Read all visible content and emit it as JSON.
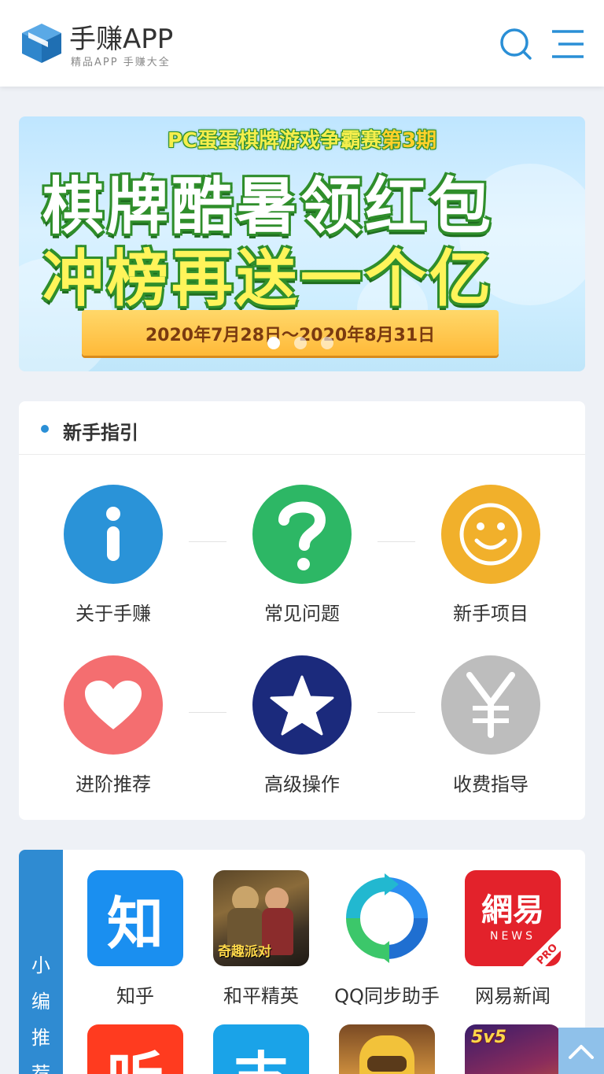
{
  "header": {
    "brand_title": "手赚APP",
    "brand_subtitle": "精品APP 手赚大全",
    "logo_icon": "cube-logo-icon",
    "search_icon": "search-icon",
    "menu_icon": "menu-icon",
    "accent": "#2a8fd6"
  },
  "banner": {
    "top_line_prefix": "PC蛋蛋棋牌游戏争霸赛",
    "top_line_highlight": "第3期",
    "line1": "棋牌酷暑领红包",
    "line2": "冲榜再送一个亿",
    "date_range": "2020年7月28日～2020年8月31日",
    "slides": 3,
    "active_slide": 1
  },
  "guide": {
    "title": "新手指引",
    "items": [
      {
        "label": "关于手赚",
        "icon": "info-icon",
        "color": "#2a93d8"
      },
      {
        "label": "常见问题",
        "icon": "question-icon",
        "color": "#2db765"
      },
      {
        "label": "新手项目",
        "icon": "smile-icon",
        "color": "#f1b02b"
      },
      {
        "label": "进阶推荐",
        "icon": "heart-icon",
        "color": "#f46e70"
      },
      {
        "label": "高级操作",
        "icon": "star-icon",
        "color": "#1b2a7c"
      },
      {
        "label": "收费指导",
        "icon": "yen-icon",
        "color": "#bdbdbd"
      }
    ]
  },
  "recommend": {
    "side_label": [
      "小",
      "编",
      "推",
      "荐"
    ],
    "apps": [
      {
        "name": "知乎",
        "icon": "zhihu-icon",
        "glyph": "知"
      },
      {
        "name": "和平精英",
        "icon": "peace-elite-icon",
        "glyph": "奇趣派对"
      },
      {
        "name": "QQ同步助手",
        "icon": "qq-sync-icon",
        "glyph": ""
      },
      {
        "name": "网易新闻",
        "icon": "netease-news-icon",
        "glyph": "網易",
        "glyph_sub": "NEWS",
        "badge": "PRO"
      },
      {
        "name": "",
        "icon": "ting-icon",
        "glyph": "听"
      },
      {
        "name": "",
        "icon": "alipay-icon",
        "glyph": "支"
      },
      {
        "name": "",
        "icon": "clash-icon",
        "glyph": ""
      },
      {
        "name": "",
        "icon": "5v5-icon",
        "glyph": "5v5"
      }
    ]
  },
  "back_to_top_icon": "chevron-up-icon"
}
